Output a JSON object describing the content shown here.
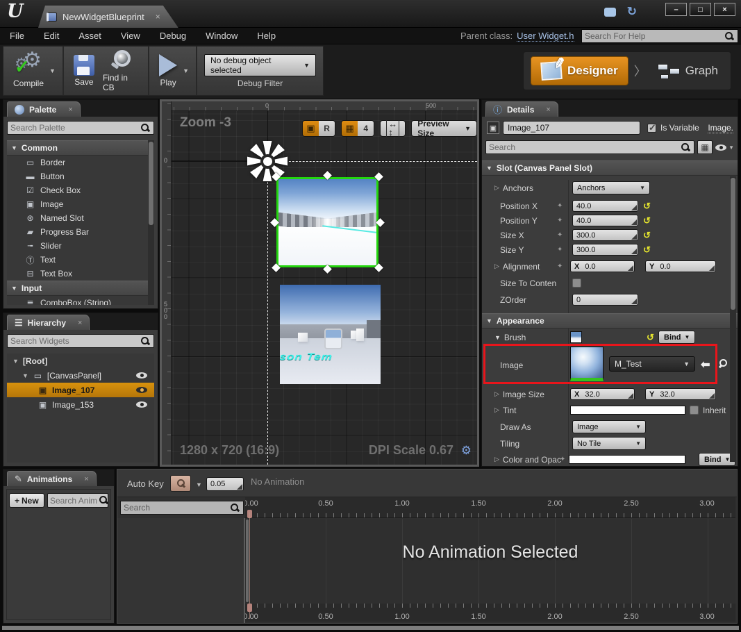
{
  "titlebar": {
    "logo": "U",
    "tab_title": "NewWidgetBlueprint",
    "tab_close": "×",
    "minimize": "–",
    "maximize": "□",
    "close": "×"
  },
  "menubar": {
    "items": [
      "File",
      "Edit",
      "Asset",
      "View",
      "Debug",
      "Window",
      "Help"
    ],
    "parent_class_label": "Parent class:",
    "parent_class_link": "User Widget.h",
    "help_search_placeholder": "Search For Help"
  },
  "toolbar": {
    "compile_label": "Compile",
    "save_label": "Save",
    "find_label": "Find in CB",
    "play_label": "Play",
    "debug_dropdown_value": "No debug object selected",
    "debug_filter_label": "Debug Filter",
    "designer_label": "Designer",
    "mode_separator": "〉",
    "graph_label": "Graph"
  },
  "palette": {
    "title": "Palette",
    "search_placeholder": "Search Palette",
    "sections": [
      {
        "label": "Common",
        "items": [
          "Border",
          "Button",
          "Check Box",
          "Image",
          "Named Slot",
          "Progress Bar",
          "Slider",
          "Text",
          "Text Box"
        ]
      },
      {
        "label": "Input",
        "items": [
          "ComboBox (String)"
        ]
      }
    ]
  },
  "hierarchy": {
    "title": "Hierarchy",
    "search_placeholder": "Search Widgets",
    "root_label": "[Root]",
    "canvas_panel_label": "[CanvasPanel]",
    "items": [
      "Image_107",
      "Image_153"
    ],
    "selected_item": "Image_107"
  },
  "canvas": {
    "zoom_label": "Zoom -3",
    "ruler_top": [
      "0",
      "500"
    ],
    "ruler_left": [
      "0",
      "500"
    ],
    "r_button": "R",
    "grid_snap_value": "4",
    "preview_size_label": "Preview Size",
    "resolution": "1280 x 720 (16:9)",
    "dpi_scale": "DPI Scale 0.67",
    "widget2_floor_text": "rson Tem"
  },
  "details": {
    "title": "Details",
    "name_value": "Image_107",
    "is_variable_label": "Is Variable",
    "category_link": "Image.",
    "search_placeholder": "Search",
    "slot_section": "Slot (Canvas Panel Slot)",
    "slot": {
      "anchors_label": "Anchors",
      "anchors_value": "Anchors",
      "position_x_label": "Position X",
      "position_x_value": "40.0",
      "position_y_label": "Position Y",
      "position_y_value": "40.0",
      "size_x_label": "Size X",
      "size_x_value": "300.0",
      "size_y_label": "Size Y",
      "size_y_value": "300.0",
      "alignment_label": "Alignment",
      "alignment_x_axis": "X",
      "alignment_x_value": "0.0",
      "alignment_y_axis": "Y",
      "alignment_y_value": "0.0",
      "size_to_content_label": "Size To Conten",
      "zorder_label": "ZOrder",
      "zorder_value": "0"
    },
    "appearance_section": "Appearance",
    "appearance": {
      "brush_label": "Brush",
      "brush_bind_label": "Bind",
      "image_label": "Image",
      "image_value": "M_Test",
      "image_size_label": "Image Size",
      "image_size_x_axis": "X",
      "image_size_x_value": "32.0",
      "image_size_y_axis": "Y",
      "image_size_y_value": "32.0",
      "tint_label": "Tint",
      "inherit_label": "Inherit",
      "draw_as_label": "Draw As",
      "draw_as_value": "Image",
      "tiling_label": "Tiling",
      "tiling_value": "No Tile",
      "color_opacity_label": "Color and Opac",
      "color_bind_label": "Bind"
    }
  },
  "animations": {
    "title": "Animations",
    "new_button_label": "New",
    "search_placeholder": "Search Anim"
  },
  "timeline": {
    "auto_key_label": "Auto Key",
    "snap_value": "0.05",
    "no_animation_label": "No Animation",
    "search_placeholder": "Search",
    "ticks": [
      "0.00",
      "0.50",
      "1.00",
      "1.50",
      "2.00",
      "2.50",
      "3.00"
    ],
    "empty_message": "No Animation Selected"
  },
  "colors": {
    "accent_orange": "#d07c00",
    "selection_green": "#24d60e",
    "highlight_red": "#e8151b",
    "link_blue": "#a9c3e8",
    "reset_yellow": "#e6e62e"
  }
}
